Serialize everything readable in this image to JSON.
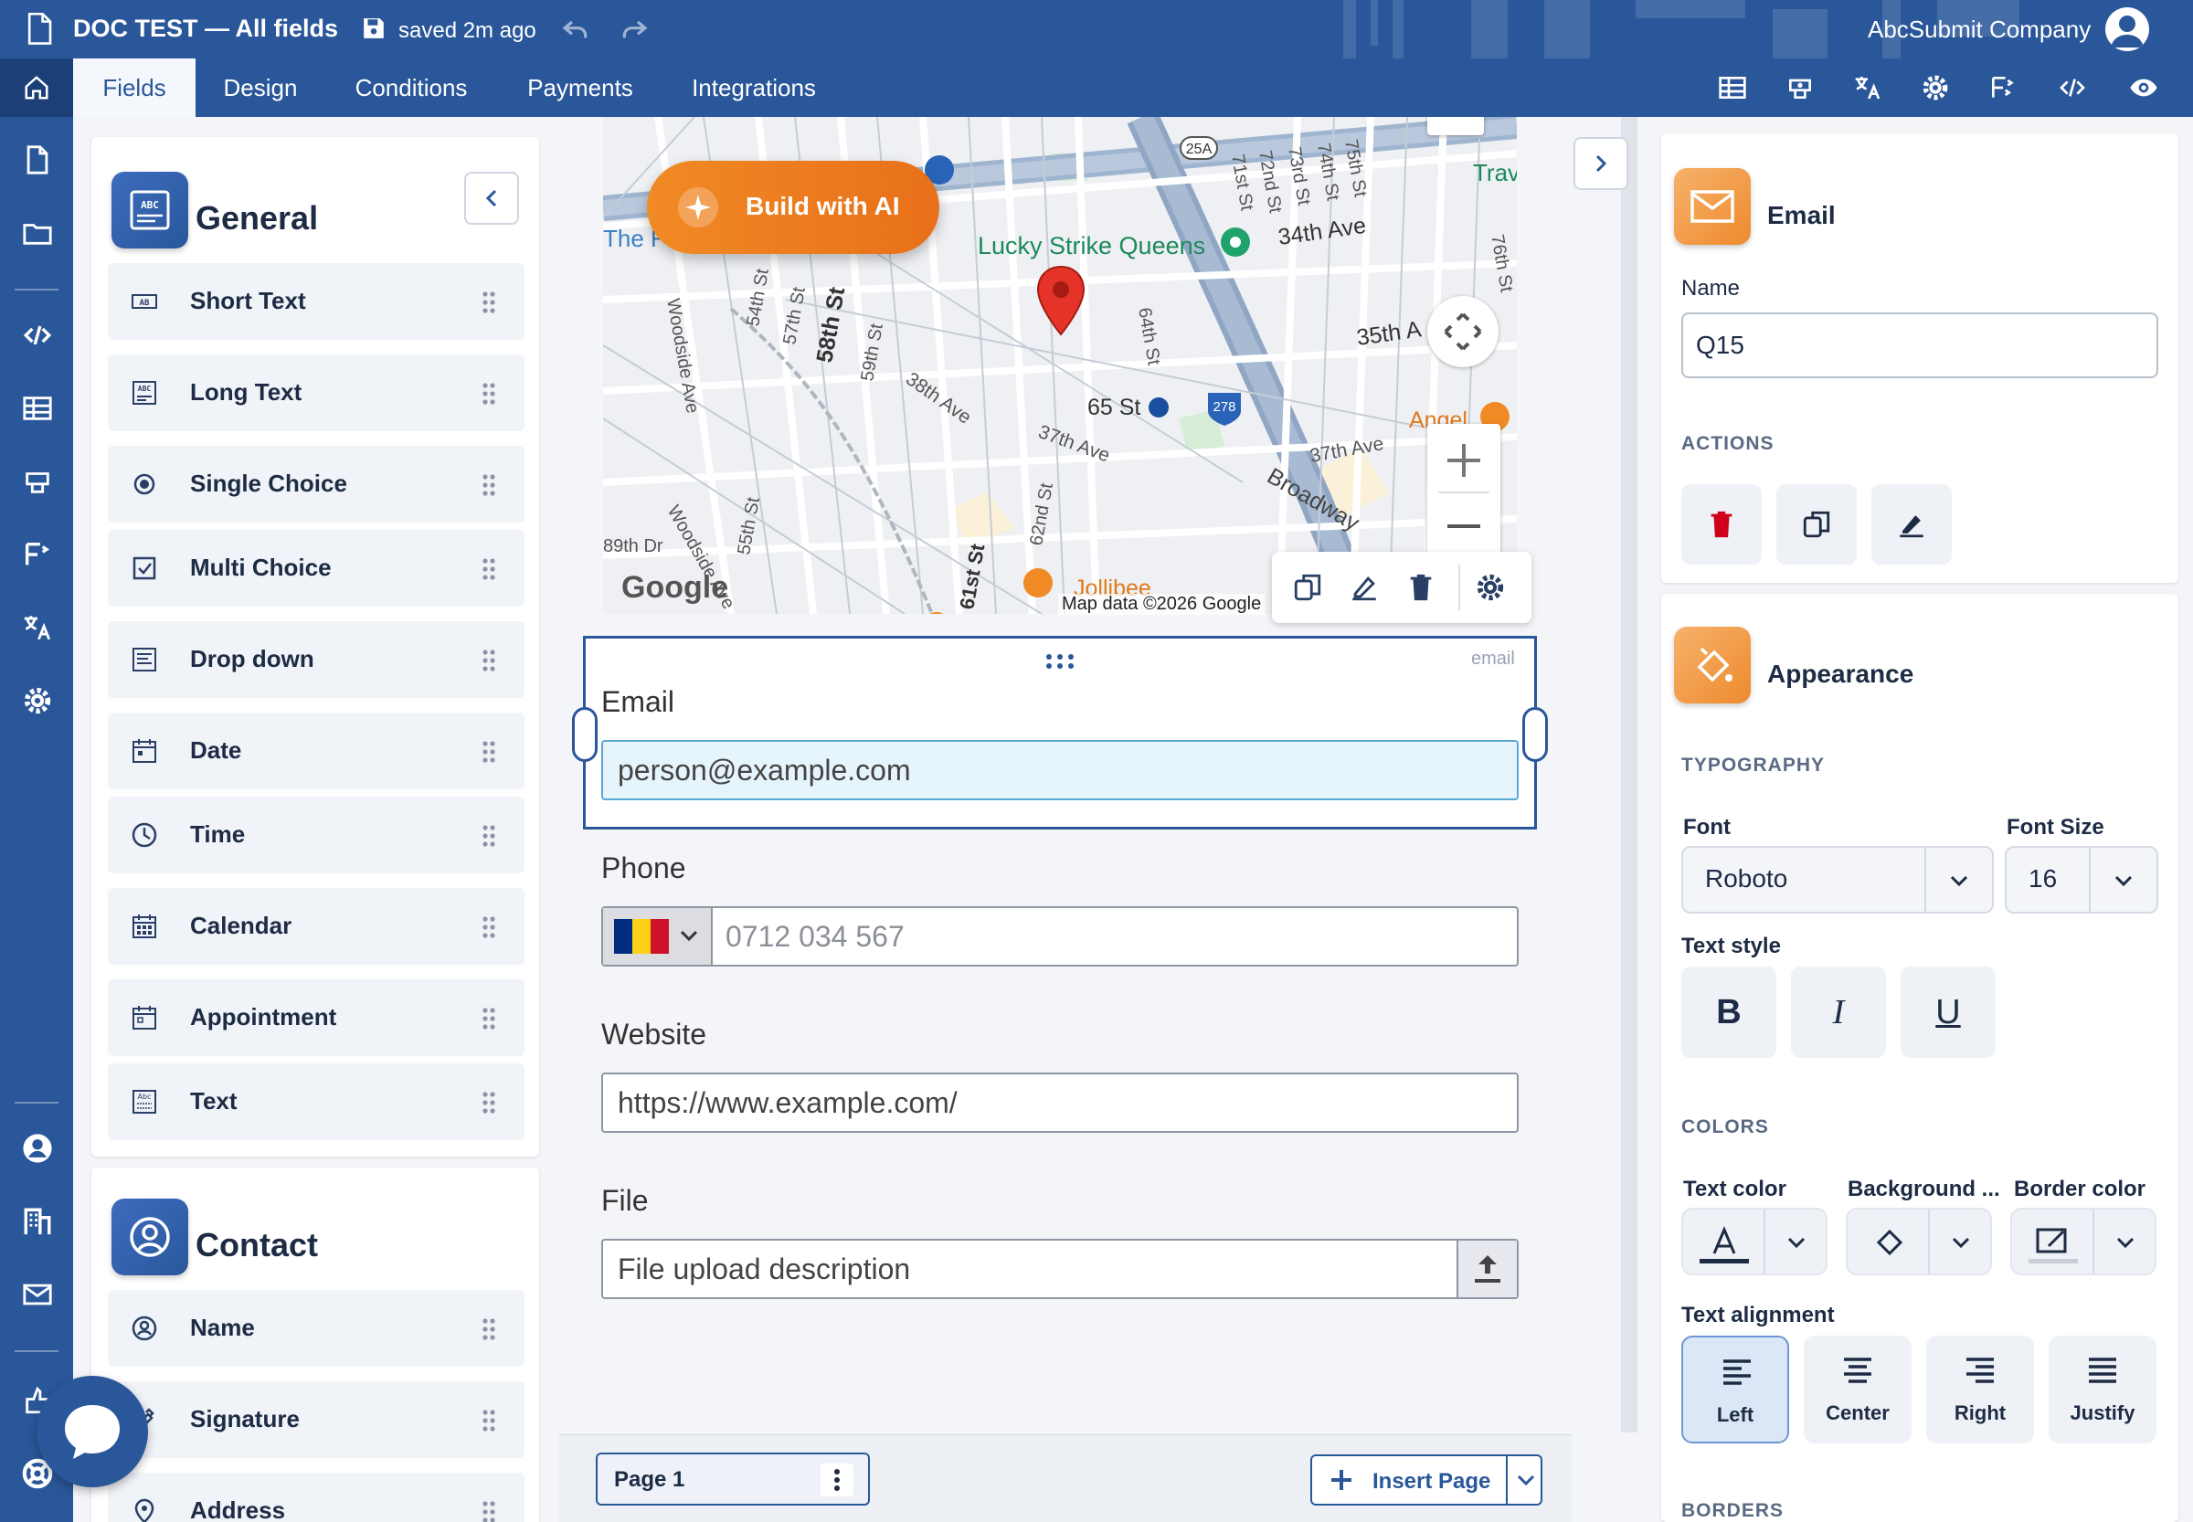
{
  "header": {
    "doc_title": "DOC TEST — All fields",
    "saved_status": "saved 2m ago",
    "company": "AbcSubmit Company"
  },
  "tabs": [
    {
      "label": "Fields",
      "active": true
    },
    {
      "label": "Design"
    },
    {
      "label": "Conditions"
    },
    {
      "label": "Payments"
    },
    {
      "label": "Integrations"
    }
  ],
  "toolbar_icons": [
    "table-icon",
    "palette-icon",
    "translate-icon",
    "settings-icon",
    "flow-icon",
    "code-icon",
    "preview-icon"
  ],
  "rail_icons": [
    "document-icon",
    "folder-icon",
    "code-icon",
    "table-icon",
    "palette-icon",
    "flow-icon",
    "translate-icon",
    "settings-icon",
    "user-icon",
    "building-icon",
    "mail-icon",
    "upgrade-icon",
    "help-icon"
  ],
  "palette": {
    "general": {
      "title": "General",
      "items": [
        {
          "label": "Short Text",
          "icon": "short-text-icon"
        },
        {
          "label": "Long Text",
          "icon": "long-text-icon"
        },
        {
          "label": "Single Choice",
          "icon": "radio-icon"
        },
        {
          "label": "Multi Choice",
          "icon": "checkbox-icon"
        },
        {
          "label": "Drop down",
          "icon": "dropdown-icon"
        },
        {
          "label": "Date",
          "icon": "date-icon"
        },
        {
          "label": "Time",
          "icon": "clock-icon"
        },
        {
          "label": "Calendar",
          "icon": "calendar-icon"
        },
        {
          "label": "Appointment",
          "icon": "appointment-icon"
        },
        {
          "label": "Text",
          "icon": "text-icon"
        }
      ]
    },
    "contact": {
      "title": "Contact",
      "items": [
        {
          "label": "Name",
          "icon": "person-icon"
        },
        {
          "label": "Signature",
          "icon": "signature-icon"
        },
        {
          "label": "Address",
          "icon": "location-icon"
        }
      ]
    }
  },
  "map": {
    "build_ai": "Build with AI",
    "labels": [
      "Lucky Strike Queens",
      "34th Ave",
      "35th A",
      "65 St",
      "37th Ave",
      "Broadway",
      "Angel",
      "Jollibee",
      "58th St",
      "57th St",
      "59th St",
      "54th St",
      "38th Ave",
      "Woodside Ave",
      "62nd St",
      "61st St",
      "55th St",
      "64th St",
      "71st St",
      "72nd St",
      "73rd St",
      "74th St",
      "75th St",
      "76th St",
      "The F",
      "Trav",
      "25A",
      "278",
      "89th Dr"
    ],
    "google": "Google",
    "credit": "Map data ©2026 Google"
  },
  "form": {
    "selected_type": "email",
    "email": {
      "label": "Email",
      "value": "person@example.com"
    },
    "phone": {
      "label": "Phone",
      "placeholder": "0712 034 567"
    },
    "website": {
      "label": "Website",
      "value": "https://www.example.com/"
    },
    "file": {
      "label": "File",
      "placeholder": "File upload description"
    }
  },
  "footer": {
    "page_label": "Page 1",
    "insert_page": "Insert Page"
  },
  "properties": {
    "title": "Email",
    "name_label": "Name",
    "name_value": "Q15",
    "actions_section": "ACTIONS",
    "appearance_title": "Appearance",
    "typography_section": "TYPOGRAPHY",
    "font_label": "Font",
    "font_value": "Roboto",
    "font_size_label": "Font Size",
    "font_size_value": "16",
    "text_style_label": "Text style",
    "style_buttons": [
      "B",
      "I",
      "U"
    ],
    "colors_section": "COLORS",
    "text_color_label": "Text color",
    "background_label": "Background ...",
    "border_color_label": "Border color",
    "text_alignment_label": "Text alignment",
    "alignments": [
      {
        "label": "Left",
        "active": true
      },
      {
        "label": "Center"
      },
      {
        "label": "Right"
      },
      {
        "label": "Justify"
      }
    ],
    "borders_section": "BORDERS"
  },
  "colors": {
    "brand": "#2a579a",
    "accent_orange": "#ee8a2e",
    "delete_red": "#d0021b",
    "email_fill": "#e6f5fb"
  }
}
